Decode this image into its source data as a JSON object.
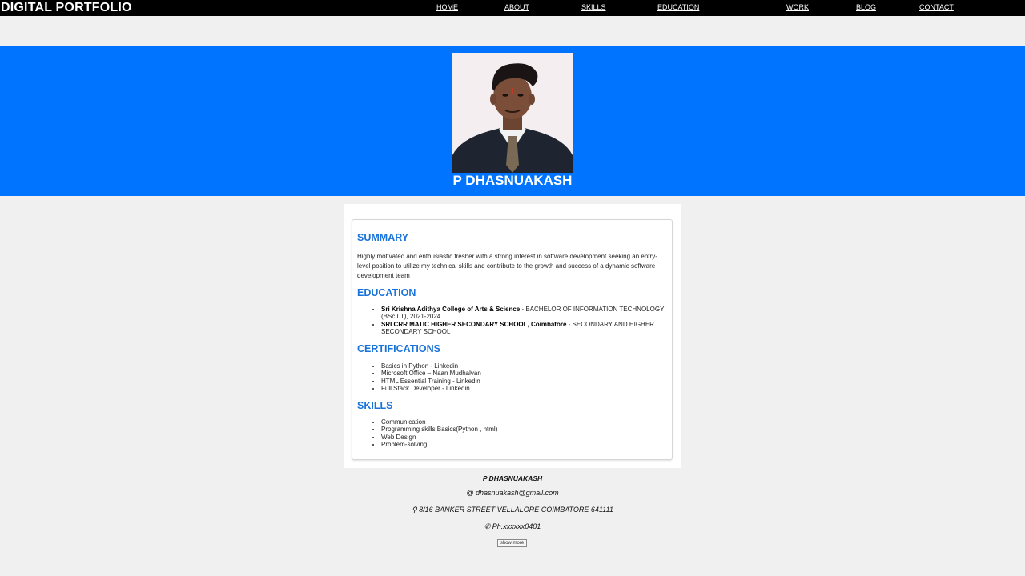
{
  "header": {
    "brand": "DIGITAL PORTFOLIO",
    "nav": [
      "HOME",
      "ABOUT",
      "SKILLS",
      "EDUCATION",
      "WORK",
      "BLOG",
      "CONTACT"
    ]
  },
  "hero": {
    "name": "P DHASNUAKASH",
    "photo_alt": "profile-photo"
  },
  "resume": {
    "summary_heading": "SUMMARY",
    "summary_text": "Highly motivated and enthusiastic fresher with a strong interest in software development seeking an entry-level position to utilize my technical skills and contribute to the growth and success of a dynamic software development team",
    "education_heading": "EDUCATION",
    "education": [
      {
        "school": "Sri Krishna Adithya College of Arts & Science",
        "detail": " - BACHELOR OF INFORMATION TECHNOLOGY (BSc I.T), 2021-2024"
      },
      {
        "school": "SRI CRR MATIC HIGHER SECONDARY SCHOOL, Coimbatore",
        "detail": " - SECONDARY AND HIGHER SECONDARY SCHOOL"
      }
    ],
    "certifications_heading": "CERTIFICATIONS",
    "certifications": [
      "Basics in Python - Linkedin",
      "Microsoft Office – Naan Mudhalvan",
      "HTML Essential Training - Linkedin",
      "Full Stack Developer - Linkedin"
    ],
    "skills_heading": "SKILLS",
    "skills": [
      "Communication",
      "Programming skills Basics(Python , html)",
      "Web Design",
      "Problem-solving"
    ]
  },
  "footer": {
    "name": "P DHASNUAKASH",
    "email": "@ dhasnuakash@gmail.com",
    "address": "⚲ 8/16 BANKER STREET VELLALORE COIMBATORE 641111",
    "phone": "✆ Ph.xxxxxx0401",
    "more_button": "show more"
  },
  "colors": {
    "topbar": "#000000",
    "hero": "#0074ff",
    "heading": "#1a73d9",
    "page_bg": "#f0f0f0"
  }
}
